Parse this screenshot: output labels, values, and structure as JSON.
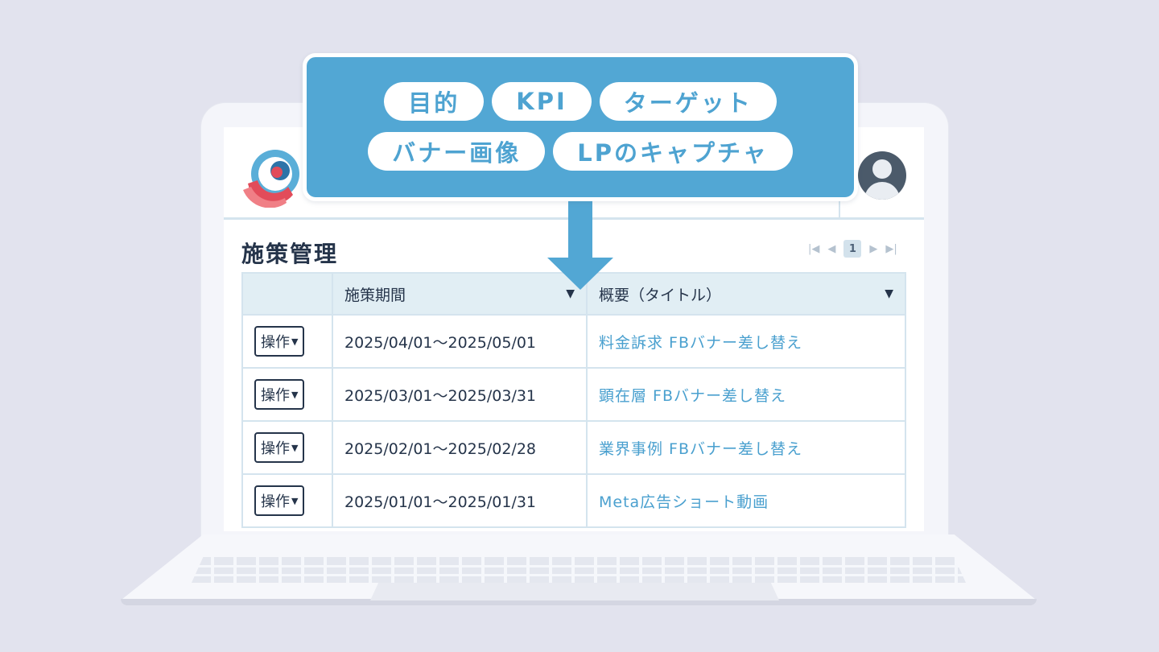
{
  "callout": {
    "tags_row1": [
      "目的",
      "KPI",
      "ターゲット"
    ],
    "tags_row2": [
      "バナー画像",
      "LPのキャプチャ"
    ],
    "color": "#52a7d4"
  },
  "header": {
    "logo_icon": "swirl-logo",
    "avatar_icon": "user-avatar-icon"
  },
  "page": {
    "title": "施策管理",
    "pagination": {
      "current_page": "1"
    }
  },
  "table": {
    "columns": [
      "",
      "施策期間",
      "概要（タイトル）"
    ],
    "rows": [
      {
        "action": "操作",
        "period": "2025/04/01〜2025/05/01",
        "title": "料金訴求 FBバナー差し替え"
      },
      {
        "action": "操作",
        "period": "2025/03/01〜2025/03/31",
        "title": "顕在層 FBバナー差し替え"
      },
      {
        "action": "操作",
        "period": "2025/02/01〜2025/02/28",
        "title": "業界事例 FBバナー差し替え"
      },
      {
        "action": "操作",
        "period": "2025/01/01〜2025/01/31",
        "title": "Meta広告ショート動画"
      }
    ]
  },
  "colors": {
    "background": "#e2e3ee",
    "accent": "#52a7d4",
    "link": "#4aa0cf",
    "text": "#25344a"
  }
}
